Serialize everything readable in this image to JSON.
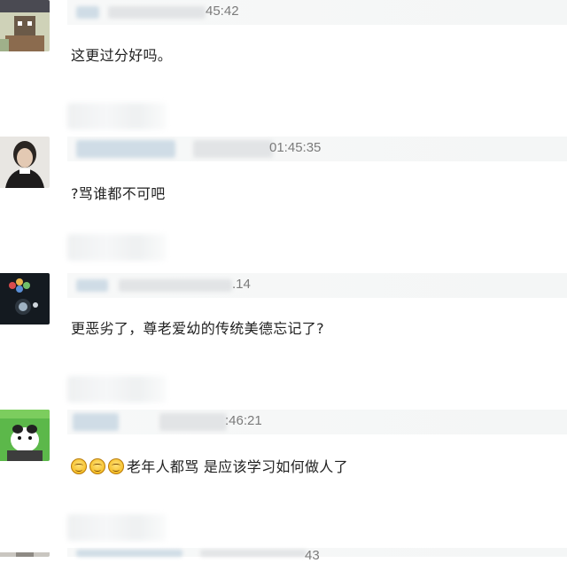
{
  "comments": [
    {
      "time_fragment": "45:42",
      "text": "这更过分好吗。"
    },
    {
      "time_fragment": "01:45:35",
      "text": "?骂谁都不可吧"
    },
    {
      "time_fragment": ".14",
      "text": "更恶劣了，尊老爱幼的传统美德忘记了?"
    },
    {
      "time_fragment": ":46:21",
      "text": "老年人都骂 是应该学习如何做人了",
      "emoji": [
        "smile-emoji",
        "smile-emoji",
        "smile-emoji"
      ]
    },
    {
      "time_fragment": "43"
    }
  ]
}
